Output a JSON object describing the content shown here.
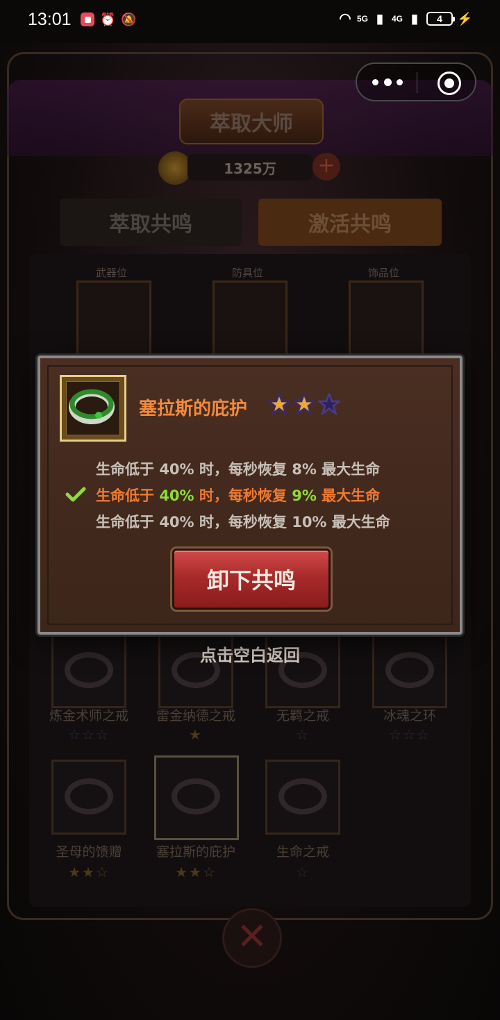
{
  "status_bar": {
    "time": "13:01",
    "network_1": "5G",
    "network_2": "4G",
    "battery": "4"
  },
  "game": {
    "title": "萃取大师",
    "currency": "1325万",
    "tabs": [
      {
        "label": "萃取共鸣"
      },
      {
        "label": "激活共鸣"
      }
    ],
    "slots": [
      {
        "label": "武器位"
      },
      {
        "label": "防具位"
      },
      {
        "label": "饰品位"
      }
    ],
    "grid": [
      {
        "name": "炼金术师之戒",
        "stars": "☆☆☆"
      },
      {
        "name": "雷金纳德之戒",
        "stars": "★"
      },
      {
        "name": "无羁之戒",
        "stars": "☆"
      },
      {
        "name": "冰魂之环",
        "stars": "☆☆☆"
      },
      {
        "name": "圣母的馈赠",
        "stars": "★★☆"
      },
      {
        "name": "塞拉斯的庇护",
        "stars": "★★☆"
      },
      {
        "name": "生命之戒",
        "stars": "☆"
      }
    ],
    "tap_back": "点击空白返回"
  },
  "modal": {
    "item_name": "塞拉斯的庇护",
    "star_count": 2,
    "star_max": 3,
    "effects": [
      {
        "prefix": "生命低于 ",
        "pct": "40%",
        "mid": " 时，每秒恢复 ",
        "val": "8%",
        "suffix": " 最大生命",
        "active": false
      },
      {
        "prefix": "生命低于 ",
        "pct": "40%",
        "mid": " 时，每秒恢复 ",
        "val": "9%",
        "suffix": " 最大生命",
        "active": true
      },
      {
        "prefix": "生命低于 ",
        "pct": "40%",
        "mid": " 时，每秒恢复 ",
        "val": "10%",
        "suffix": " 最大生命",
        "active": false
      }
    ],
    "button": "卸下共鸣"
  },
  "colors": {
    "item_name": "#f08a3e",
    "active_effect": "#f07a30",
    "highlight_value": "#8edb3a",
    "button": "#b83030"
  }
}
